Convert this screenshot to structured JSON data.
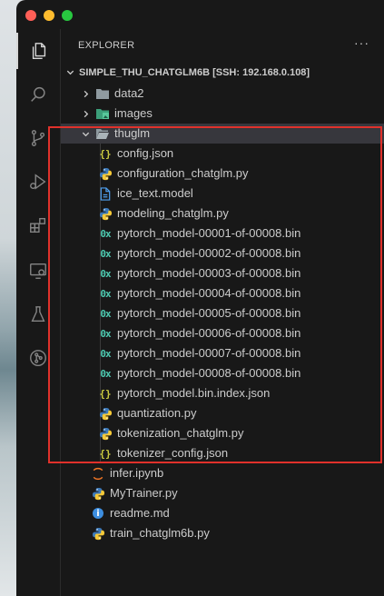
{
  "window": {
    "traffic_colors": {
      "close": "#ff5f57",
      "minimize": "#febc2e",
      "maximize": "#28c840"
    }
  },
  "activity_bar": {
    "icons": [
      "files-icon",
      "search-icon",
      "source-control-icon",
      "run-debug-icon",
      "extensions-icon",
      "remote-explorer-icon",
      "testing-icon",
      "git-graph-icon"
    ],
    "active": "files-icon"
  },
  "explorer": {
    "title": "EXPLORER",
    "more_label": "···",
    "root": {
      "label": "SIMPLE_THU_CHATGLM6B [SSH: 192.168.0.108]",
      "expanded": true
    },
    "items": [
      {
        "label": "data2",
        "type": "folder",
        "expanded": false,
        "level": 1
      },
      {
        "label": "images",
        "type": "folder-images",
        "expanded": false,
        "level": 1
      },
      {
        "label": "thuglm",
        "type": "folder",
        "expanded": true,
        "level": 1,
        "selected": true
      },
      {
        "label": "config.json",
        "type": "json",
        "level": 2
      },
      {
        "label": "configuration_chatglm.py",
        "type": "python",
        "level": 2
      },
      {
        "label": "ice_text.model",
        "type": "file",
        "level": 2
      },
      {
        "label": "modeling_chatglm.py",
        "type": "python",
        "level": 2
      },
      {
        "label": "pytorch_model-00001-of-00008.bin",
        "type": "binary",
        "level": 2
      },
      {
        "label": "pytorch_model-00002-of-00008.bin",
        "type": "binary",
        "level": 2
      },
      {
        "label": "pytorch_model-00003-of-00008.bin",
        "type": "binary",
        "level": 2
      },
      {
        "label": "pytorch_model-00004-of-00008.bin",
        "type": "binary",
        "level": 2
      },
      {
        "label": "pytorch_model-00005-of-00008.bin",
        "type": "binary",
        "level": 2
      },
      {
        "label": "pytorch_model-00006-of-00008.bin",
        "type": "binary",
        "level": 2
      },
      {
        "label": "pytorch_model-00007-of-00008.bin",
        "type": "binary",
        "level": 2
      },
      {
        "label": "pytorch_model-00008-of-00008.bin",
        "type": "binary",
        "level": 2
      },
      {
        "label": "pytorch_model.bin.index.json",
        "type": "json",
        "level": 2
      },
      {
        "label": "quantization.py",
        "type": "python",
        "level": 2
      },
      {
        "label": "tokenization_chatglm.py",
        "type": "python",
        "level": 2
      },
      {
        "label": "tokenizer_config.json",
        "type": "json",
        "level": 2
      },
      {
        "label": "infer.ipynb",
        "type": "jupyter",
        "level": 1
      },
      {
        "label": "MyTrainer.py",
        "type": "python",
        "level": 1
      },
      {
        "label": "readme.md",
        "type": "info",
        "level": 1
      },
      {
        "label": "train_chatglm6b.py",
        "type": "python",
        "level": 1
      }
    ],
    "icon_glyphs": {
      "json": "{}",
      "binary": "0x",
      "info": "i"
    }
  },
  "annotation": {
    "highlight_color": "#e0312b"
  }
}
